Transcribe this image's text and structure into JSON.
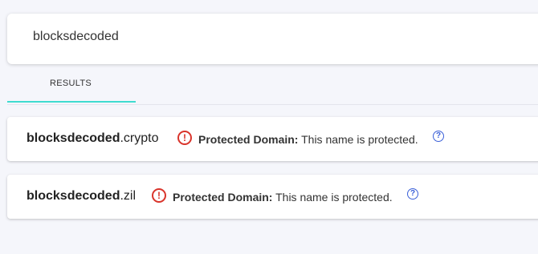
{
  "search": {
    "value": "blocksdecoded"
  },
  "tabs": [
    {
      "label": "RESULTS",
      "active": true
    }
  ],
  "colors": {
    "accent_tab": "#3fdbd0",
    "warning": "#d9342b",
    "help": "#3a5fd8"
  },
  "results": [
    {
      "name": "blocksdecoded",
      "extension": ".crypto",
      "status_icon": "warning-circle-icon",
      "status_label": "Protected Domain:",
      "status_text": "This name is protected.",
      "help_icon": "question-circle-icon"
    },
    {
      "name": "blocksdecoded",
      "extension": ".zil",
      "status_icon": "warning-circle-icon",
      "status_label": "Protected Domain:",
      "status_text": "This name is protected.",
      "help_icon": "question-circle-icon"
    }
  ]
}
